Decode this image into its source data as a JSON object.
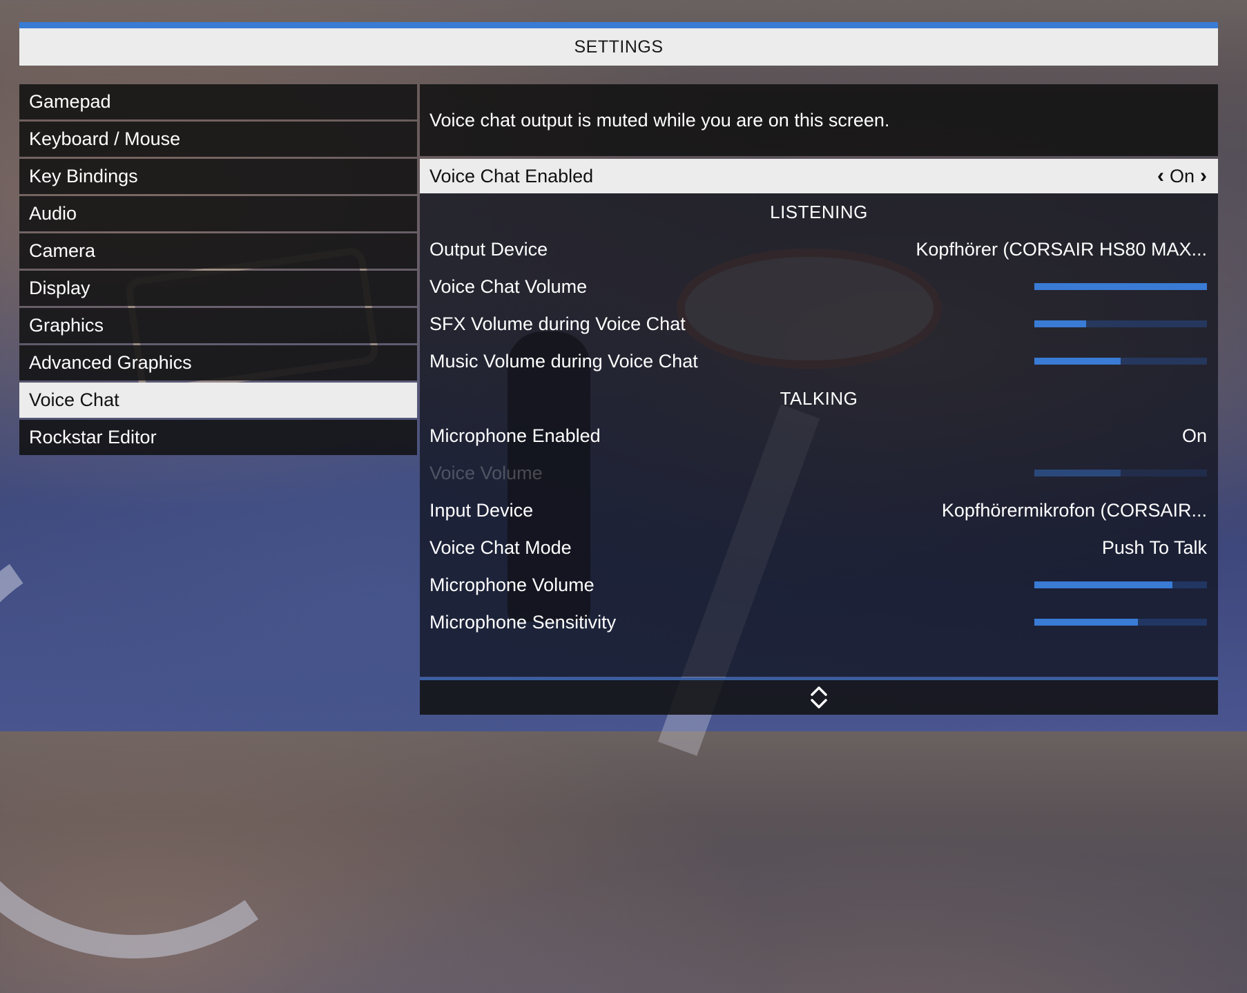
{
  "header": {
    "title": "SETTINGS",
    "accent_color": "#3a7bd5"
  },
  "menu": {
    "items": [
      {
        "label": "Gamepad"
      },
      {
        "label": "Keyboard / Mouse"
      },
      {
        "label": "Key Bindings"
      },
      {
        "label": "Audio"
      },
      {
        "label": "Camera"
      },
      {
        "label": "Display"
      },
      {
        "label": "Graphics"
      },
      {
        "label": "Advanced Graphics"
      },
      {
        "label": "Voice Chat"
      },
      {
        "label": "Rockstar Editor"
      }
    ],
    "selected": "Voice Chat"
  },
  "panel": {
    "info": "Voice chat output is muted while you are on this screen.",
    "voice_chat_enabled": {
      "label": "Voice Chat Enabled",
      "value": "On"
    },
    "listening": {
      "title": "LISTENING",
      "output_device": {
        "label": "Output Device",
        "value": "Kopfhörer (CORSAIR HS80 MAX..."
      },
      "voice_chat_volume": {
        "label": "Voice Chat Volume",
        "level": 1.0
      },
      "sfx_volume": {
        "label": "SFX Volume during Voice Chat",
        "level": 0.3
      },
      "music_volume": {
        "label": "Music Volume during Voice Chat",
        "level": 0.5
      }
    },
    "talking": {
      "title": "TALKING",
      "microphone_enabled": {
        "label": "Microphone Enabled",
        "value": "On"
      },
      "voice_volume": {
        "label": "Voice Volume",
        "level": 0.5,
        "disabled": true
      },
      "input_device": {
        "label": "Input Device",
        "value": "Kopfhörermikrofon (CORSAIR..."
      },
      "voice_chat_mode": {
        "label": "Voice Chat Mode",
        "value": "Push To Talk"
      },
      "microphone_volume": {
        "label": "Microphone Volume",
        "level": 0.8
      },
      "microphone_sensitivity": {
        "label": "Microphone Sensitivity",
        "level": 0.6
      }
    }
  },
  "footer": {
    "icon": "scroll-up-down-icon"
  }
}
